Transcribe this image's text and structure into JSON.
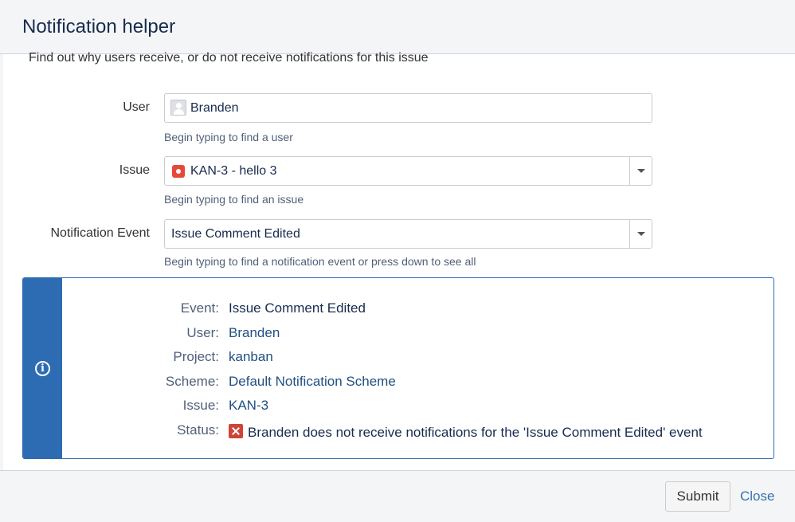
{
  "dialog": {
    "title": "Notification helper",
    "description": "Find out why users receive, or do not receive notifications for this issue"
  },
  "form": {
    "user": {
      "label": "User",
      "value": "Branden",
      "help": "Begin typing to find a user",
      "icon": "avatar-icon"
    },
    "issue": {
      "label": "Issue",
      "value": "KAN-3 - hello 3",
      "help": "Begin typing to find an issue",
      "icon": "bug-icon",
      "icon_color": "#e5493a"
    },
    "event": {
      "label": "Notification Event",
      "value": "Issue Comment Edited",
      "help": "Begin typing to find a notification event or press down to see all"
    }
  },
  "result": {
    "accent_color": "#2d6bb3",
    "icon": "info-icon",
    "rows": {
      "event": {
        "key": "Event:",
        "value": "Issue Comment Edited"
      },
      "user": {
        "key": "User:",
        "value": "Branden"
      },
      "project": {
        "key": "Project:",
        "value": "kanban"
      },
      "scheme": {
        "key": "Scheme:",
        "value": "Default Notification Scheme"
      },
      "issue": {
        "key": "Issue:",
        "value": "KAN-3"
      },
      "status": {
        "key": "Status:",
        "value": "Branden does not receive notifications for the 'Issue Comment Edited' event",
        "icon": "error-icon",
        "icon_color": "#d04437"
      }
    }
  },
  "footer": {
    "submit_label": "Submit",
    "close_label": "Close"
  }
}
